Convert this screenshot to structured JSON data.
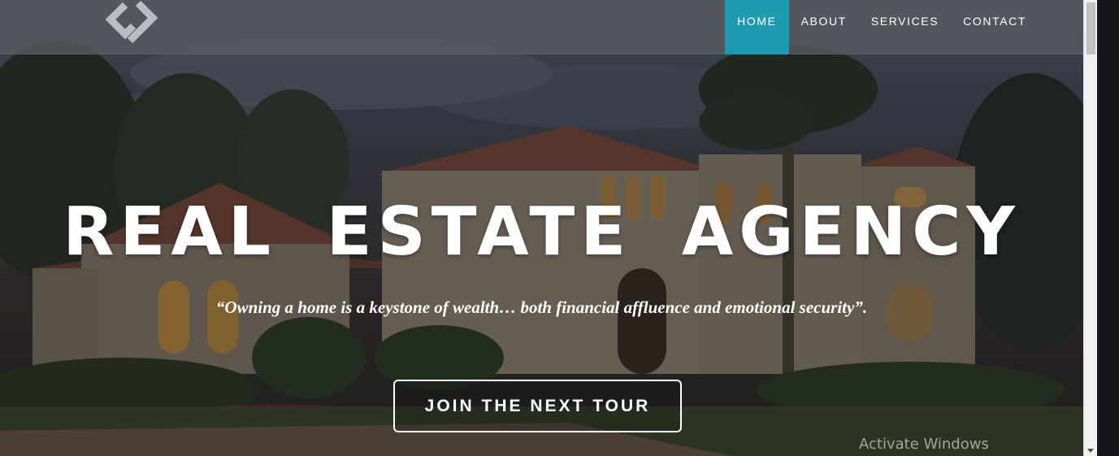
{
  "navbar": {
    "logo_icon": "gs-logo-icon",
    "items": [
      {
        "label": "HOME",
        "active": true
      },
      {
        "label": "ABOUT",
        "active": false
      },
      {
        "label": "SERVICES",
        "active": false
      },
      {
        "label": "CONTACT",
        "active": false
      }
    ]
  },
  "hero": {
    "title": "REAL ESTATE AGENCY",
    "tagline": "“Owning a home is a keystone of wealth… both financial affluence and emotional security”.",
    "cta_label": "JOIN THE NEXT TOUR"
  },
  "system": {
    "watermark": "Activate Windows"
  },
  "colors": {
    "accent": "#1e9bb1",
    "text": "#ffffff",
    "navbar_bg": "#585c62"
  }
}
